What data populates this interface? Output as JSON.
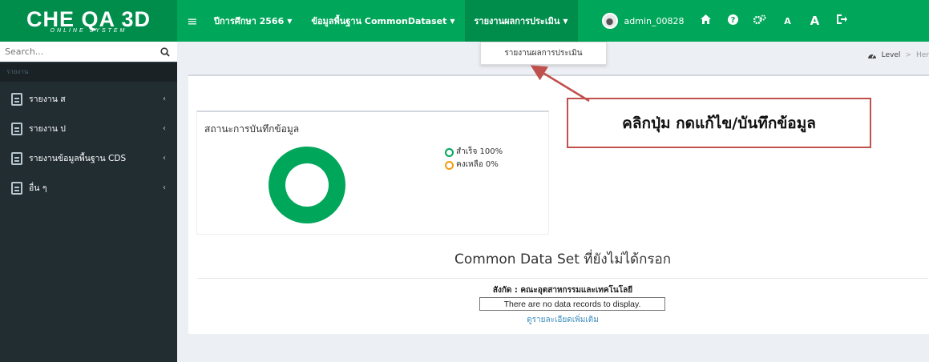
{
  "app": {
    "logo_main": "CHE QA 3D",
    "logo_sub": "ONLINE SYSTEM"
  },
  "topnav": {
    "year_label": "ปีการศึกษา 2566",
    "cds_label": "ข้อมูลพื้นฐาน CommonDataset",
    "report_label": "รายงานผลการประเมิน",
    "username": "admin_00828",
    "font_small": "A",
    "font_large": "A",
    "icons": [
      "menu-icon",
      "home-icon",
      "help-icon",
      "settings-icon",
      "logout-icon"
    ]
  },
  "dropdown": {
    "item_label": "รายงานผลการประเมิน"
  },
  "sidebar": {
    "search_placeholder": "Search...",
    "header": "รายงาน",
    "items": [
      {
        "label": "รายงาน ส"
      },
      {
        "label": "รายงาน ป"
      },
      {
        "label": "รายงานข้อมูลพื้นฐาน CDS"
      },
      {
        "label": "อื่น ๆ"
      }
    ]
  },
  "breadcrumb": {
    "level": "Level",
    "here": "Her"
  },
  "chart": {
    "title": "สถานะการบันทึกข้อมูล",
    "success_label": "สำเร็จ 100%",
    "remaining_label": "คงเหลือ 0%",
    "success_color": "#00a65a",
    "remaining_color": "#f39c12"
  },
  "chart_data": {
    "type": "pie",
    "categories": [
      "สำเร็จ",
      "คงเหลือ"
    ],
    "values": [
      100,
      0
    ],
    "colors": [
      "#00a65a",
      "#f39c12"
    ],
    "donut": true
  },
  "section": {
    "title": "Common Data Set ที่ยังไม่ได้กรอก",
    "affiliation": "สังกัด : คณะอุตสาหกรรมและเทคโนโลยี",
    "no_data": "There are no data records to display.",
    "more_link": "ดูรายละเอียดเพิ่มเติม"
  },
  "callout": {
    "text": "คลิกปุ่ม กดแก้ไข/บันทึกข้อมูล",
    "border_color": "#c0504d"
  }
}
